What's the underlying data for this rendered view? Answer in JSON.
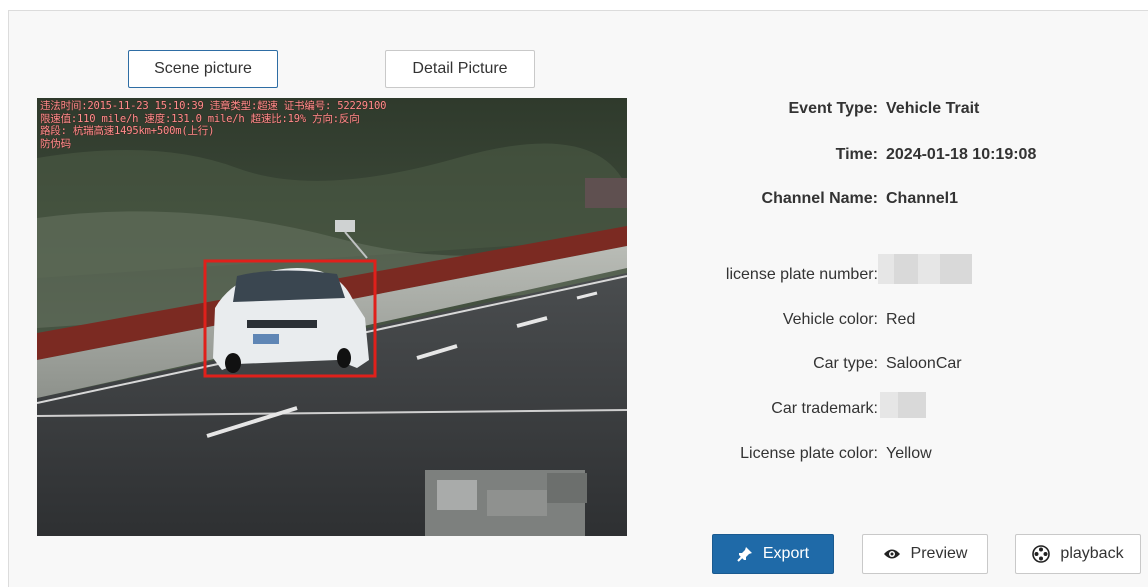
{
  "tabs": {
    "scene_label": "Scene picture",
    "detail_label": "Detail Picture"
  },
  "photo_overlay": {
    "line1": "违法时间:2015-11-23 15:10:39 违章类型:超速 证书编号: 52229100",
    "line2": "限速值:110 mile/h 速度:131.0 mile/h 超速比:19% 方向:反向",
    "line3": "路段: 杭瑞高速1495km+500m(上行)",
    "line4": "防伪码"
  },
  "event": {
    "type_label": "Event Type:",
    "type_value": "Vehicle Trait",
    "time_label": "Time:",
    "time_value": "2024-01-18 10:19:08",
    "channel_label": "Channel Name:",
    "channel_value": "Channel1"
  },
  "vehicle": {
    "plate_label": "license plate number:",
    "color_label": "Vehicle color:",
    "color_value": "Red",
    "type_label": "Car type:",
    "type_value": "SaloonCar",
    "trademark_label": "Car trademark:",
    "plate_color_label": "License plate color:",
    "plate_color_value": "Yellow"
  },
  "actions": {
    "export_label": "Export",
    "preview_label": "Preview",
    "playback_label": "playback"
  },
  "colors": {
    "accent": "#1f6aa8",
    "highlight_box": "#e0201b"
  }
}
